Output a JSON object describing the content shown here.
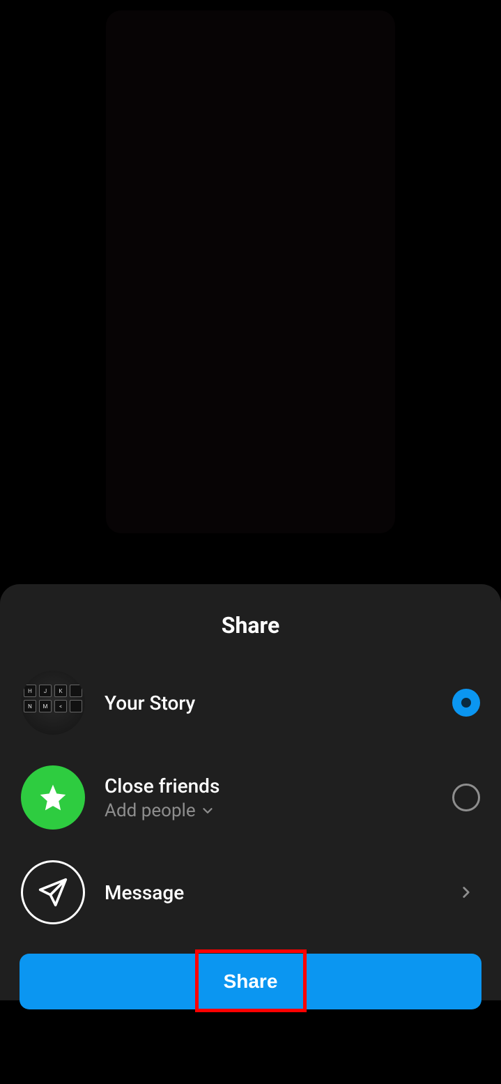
{
  "sheet": {
    "title": "Share",
    "options": {
      "your_story": {
        "label": "Your Story",
        "selected": true
      },
      "close_friends": {
        "label": "Close friends",
        "sublabel": "Add people",
        "selected": false
      },
      "message": {
        "label": "Message"
      }
    },
    "share_button": "Share"
  },
  "colors": {
    "accent_blue": "#0b96f1",
    "close_friends_green": "#2ecc40",
    "highlight_red": "#ff0000"
  }
}
